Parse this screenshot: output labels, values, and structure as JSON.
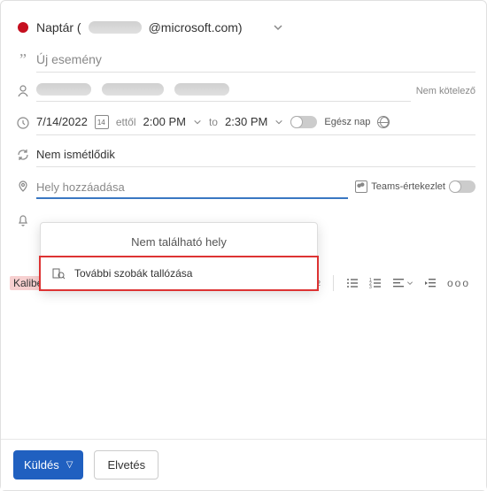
{
  "calendar": {
    "prefix": "Naptár (",
    "email_suffix": "@microsoft.com)"
  },
  "title": {
    "placeholder": "Új esemény"
  },
  "attendees": {
    "optional_label": "Nem kötelező"
  },
  "time": {
    "date": "7/14/2022",
    "from_label": "ettől",
    "start": "2:00 PM",
    "to_label": "to",
    "end": "2:30 PM",
    "allday_label": "Egész nap"
  },
  "recurrence": {
    "label": "Nem ismétlődik"
  },
  "location": {
    "placeholder": "Hely hozzáadása",
    "teams_label": "Teams-értekezlet"
  },
  "location_dropdown": {
    "no_result": "Nem található hely",
    "browse_more": "További szobák tallózása"
  },
  "toolbar": {
    "font_label": "Kaliber"
  },
  "buttons": {
    "send": "Küldés",
    "discard": "Elvetés"
  }
}
